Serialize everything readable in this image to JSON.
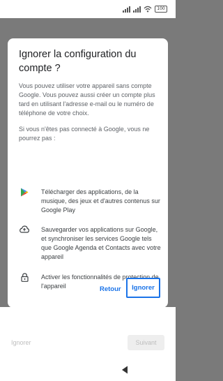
{
  "status_bar": {
    "icons": [
      "signal-icon",
      "signal-icon",
      "wifi-icon",
      "battery-icon"
    ],
    "battery": "100"
  },
  "dialog": {
    "title": "Ignorer la configuration du compte ?",
    "body": "Vous pouvez utiliser votre appareil sans compte Google. Vous pouvez aussi créer un compte plus tard en utilisant l'adresse e-mail ou le numéro de téléphone de votre choix.",
    "sub": "Si vous n'êtes pas connecté à Google, vous ne pourrez pas :",
    "features": [
      {
        "icon": "google-play-icon",
        "text": "Télécharger des applications, de la musique, des jeux et d'autres contenus sur Google Play"
      },
      {
        "icon": "cloud-upload-icon",
        "text": "Sauvegarder vos applications sur Google, et synchroniser les services Google tels que Google Agenda et Contacts avec votre appareil"
      },
      {
        "icon": "lock-icon",
        "text": "Activer les fonctionnalités de protection de l'appareil"
      }
    ],
    "buttons": {
      "back": "Retour",
      "skip": "Ignorer"
    }
  },
  "bottom": {
    "skip": "Ignorer",
    "next": "Suivant"
  },
  "colors": {
    "accent": "#1a73e8",
    "scrim": "#7a7a7a"
  }
}
